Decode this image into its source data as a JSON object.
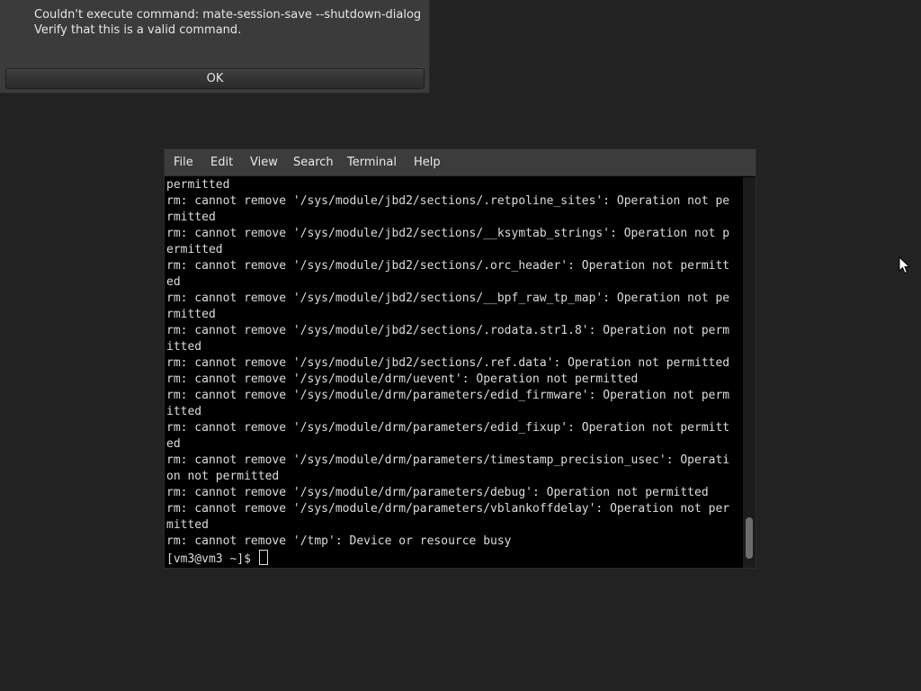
{
  "dialog": {
    "message_line1": "Couldn't execute command: mate-session-save --shutdown-dialog",
    "message_line2": "Verify that this is a valid command.",
    "ok_label": "OK"
  },
  "terminal": {
    "menu": [
      "File",
      "Edit",
      "View",
      "Search",
      "Terminal",
      "Help"
    ],
    "lines": [
      "permitted",
      "rm: cannot remove '/sys/module/jbd2/sections/.retpoline_sites': Operation not pe",
      "rmitted",
      "rm: cannot remove '/sys/module/jbd2/sections/__ksymtab_strings': Operation not p",
      "ermitted",
      "rm: cannot remove '/sys/module/jbd2/sections/.orc_header': Operation not permitt",
      "ed",
      "rm: cannot remove '/sys/module/jbd2/sections/__bpf_raw_tp_map': Operation not pe",
      "rmitted",
      "rm: cannot remove '/sys/module/jbd2/sections/.rodata.str1.8': Operation not perm",
      "itted",
      "rm: cannot remove '/sys/module/jbd2/sections/.ref.data': Operation not permitted",
      "rm: cannot remove '/sys/module/drm/uevent': Operation not permitted",
      "rm: cannot remove '/sys/module/drm/parameters/edid_firmware': Operation not perm",
      "itted",
      "rm: cannot remove '/sys/module/drm/parameters/edid_fixup': Operation not permitt",
      "ed",
      "rm: cannot remove '/sys/module/drm/parameters/timestamp_precision_usec': Operati",
      "on not permitted",
      "rm: cannot remove '/sys/module/drm/parameters/debug': Operation not permitted",
      "rm: cannot remove '/sys/module/drm/parameters/vblankoffdelay': Operation not per",
      "mitted",
      "rm: cannot remove '/tmp': Device or resource busy"
    ],
    "prompt": "[vm3@vm3 ~]$ "
  }
}
